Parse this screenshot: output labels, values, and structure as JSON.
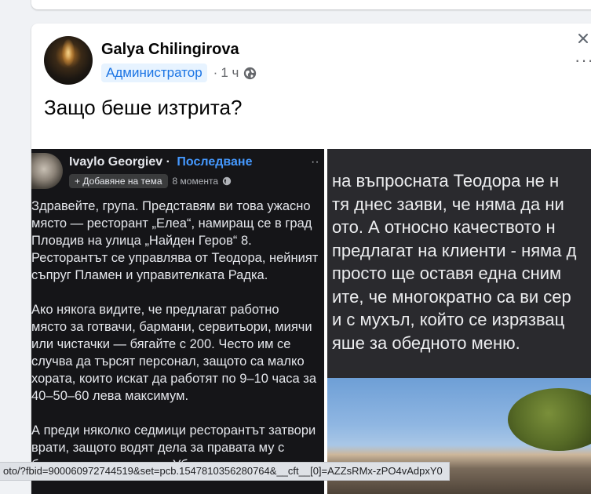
{
  "post": {
    "author": "Galya Chilingirova",
    "role_badge": "Администратор",
    "time": "1 ч",
    "text": "Защо беше изтрита?"
  },
  "screenshot_left": {
    "author": "Ivaylo Georgiev",
    "separator": "·",
    "follow": "Последване",
    "add_topic": "+ Добавяне на тема",
    "time": "8 момента",
    "lines": [
      "Здравейте, група. Представям ви това ужасно",
      "място — ресторант „Елеа“, намиращ се в град",
      "Пловдив на улица „Найден Геров“ 8.",
      "Ресторантът се управлява от Теодора, нейният",
      "съпруг Пламен и управителката Радка.",
      "",
      "Ако някога видите, че предлагат работно",
      "място за готвачи, бармани, сервитьори, миячи",
      "или чистачки — бягайте с 200. Често им се",
      "случва да търсят персонал, защото са малко",
      "хората, които искат да работят по 9–10 часа за",
      "40–50–60 лева максимум.",
      "",
      "А преди няколко седмици ресторантът затвори",
      "врати, защото водят дела за правата му с",
      "бившия им съдружник. Убеждаваха всички от"
    ]
  },
  "screenshot_right": {
    "lines": [
      "на въпросната Теодора не н",
      "тя днес заяви, че няма да ни",
      "ото. А относно качеството н",
      "предлагат на клиенти - няма д",
      "просто ще оставя една сним",
      "ите, че многократно са ви сер",
      "и с мухъл, който се изрязвац",
      "яше за обедното меню."
    ]
  },
  "status_bar": {
    "url": "oto/?fbid=900060972744519&set=pcb.1547810356280764&__cft__[0]=AZZsRMx-zPO4vAdpxY0"
  }
}
